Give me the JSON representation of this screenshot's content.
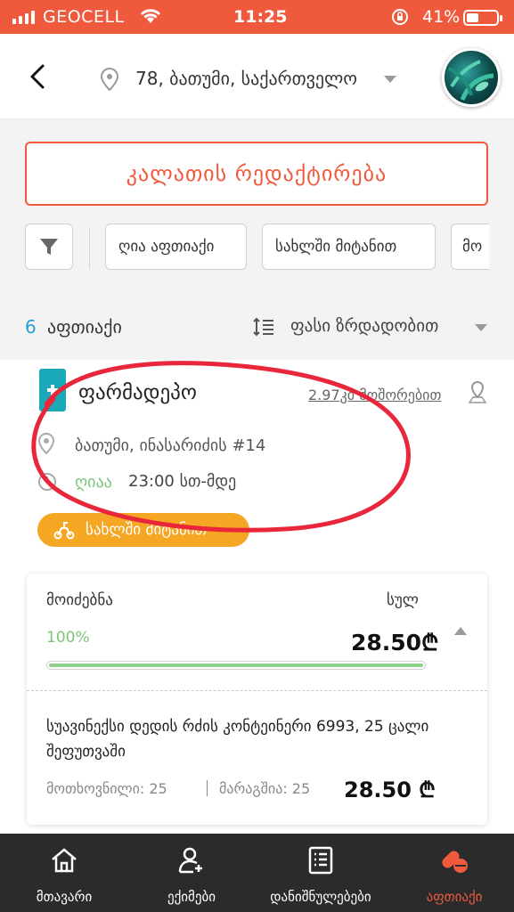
{
  "status_bar": {
    "carrier": "GEOCELL",
    "time": "11:25",
    "battery_percent": "41%",
    "battery_level": 0.41
  },
  "header": {
    "location": "78, ბათუმი, საქართველო",
    "icons": [
      "back-icon",
      "location-pin-icon",
      "chevron-down-icon",
      "avatar"
    ]
  },
  "edit_cart_label": "კალათის რედაქტირება",
  "filters": {
    "chips": [
      "ღია აფთიაქი",
      "სახლში მიტანით",
      "მო"
    ]
  },
  "list": {
    "count": "6",
    "count_label": "აფთიაქი",
    "sort_label": "ფასი ზრდადობით"
  },
  "pharmacy": {
    "name": "ფარმადეპო",
    "distance": "2.97კმ მოშორებით",
    "address": "ბათუმი, ინასარიძის #14",
    "open_status": "ღიაა",
    "hours": "23:00 სთ-მდე",
    "delivery_badge": "სახლში მიტანით",
    "order": {
      "available_label": "მოიძებნა",
      "total_label": "სულ",
      "available_percent": "100%",
      "available_fraction": 1.0,
      "total_value": "28.50₾",
      "item_name": "სუავინექსი დედის რძის კონტეინერი 6993, 25 ცალი შეფუთვაში",
      "requested": "მოთხოვნილი: 25",
      "in_stock": "მარაგშია: 25",
      "item_price": "28.50 ₾"
    }
  },
  "bottom_nav": {
    "items": [
      {
        "label": "მთავარი",
        "icon": "home-icon"
      },
      {
        "label": "ექიმები",
        "icon": "doctor-icon"
      },
      {
        "label": "დანიშნულებები",
        "icon": "prescription-icon"
      },
      {
        "label": "აფთიაქი",
        "icon": "pharmacy-icon"
      }
    ],
    "active_color": "#f05a3c"
  },
  "colors": {
    "accent": "#f05a3c",
    "delivery": "#f5a623",
    "success": "#7cc47a",
    "link_blue": "#2a9fd6"
  }
}
